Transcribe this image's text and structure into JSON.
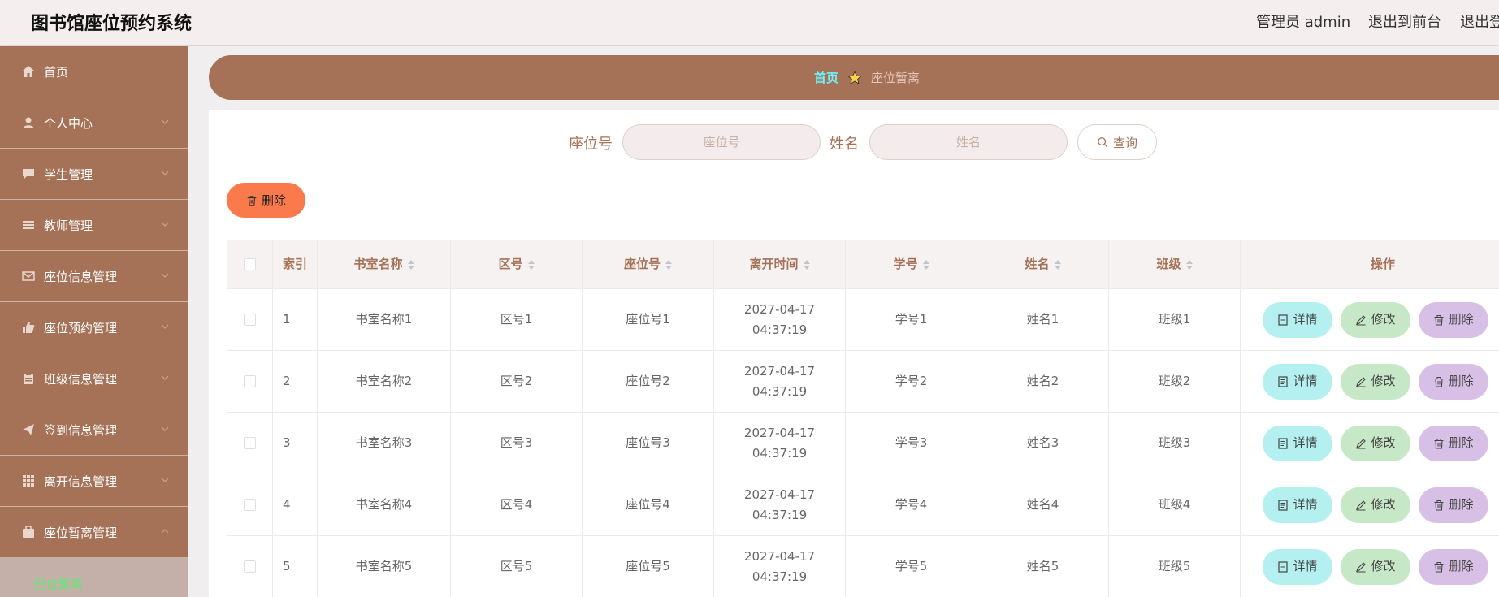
{
  "header": {
    "title": "图书馆座位预约系统",
    "admin": "管理员 admin",
    "to_front": "退出到前台",
    "logout": "退出登录"
  },
  "sidebar": {
    "items": [
      {
        "label": "首页",
        "icon": "home-icon"
      },
      {
        "label": "个人中心",
        "icon": "user-icon"
      },
      {
        "label": "学生管理",
        "icon": "chat-icon"
      },
      {
        "label": "教师管理",
        "icon": "list-icon"
      },
      {
        "label": "座位信息管理",
        "icon": "mail-icon"
      },
      {
        "label": "座位预约管理",
        "icon": "thumb-icon"
      },
      {
        "label": "班级信息管理",
        "icon": "clipboard-icon"
      },
      {
        "label": "签到信息管理",
        "icon": "send-icon"
      },
      {
        "label": "离开信息管理",
        "icon": "grid-icon"
      },
      {
        "label": "座位暂离管理",
        "icon": "briefcase-icon"
      }
    ],
    "active_sub": "座位暂离"
  },
  "breadcrumb": {
    "home": "首页",
    "current": "座位暂离"
  },
  "search": {
    "seat_label": "座位号",
    "seat_placeholder": "座位号",
    "name_label": "姓名",
    "name_placeholder": "姓名",
    "query_label": "查询"
  },
  "actions": {
    "batch_delete": "删除",
    "detail": "详情",
    "edit": "修改",
    "delete": "删除"
  },
  "table": {
    "headers": [
      "索引",
      "书室名称",
      "区号",
      "座位号",
      "离开时间",
      "学号",
      "姓名",
      "班级",
      "操作"
    ],
    "rows": [
      [
        "1",
        "书室名称1",
        "区号1",
        "座位号1",
        "2027-04-17 04:37:19",
        "学号1",
        "姓名1",
        "班级1"
      ],
      [
        "2",
        "书室名称2",
        "区号2",
        "座位号2",
        "2027-04-17 04:37:19",
        "学号2",
        "姓名2",
        "班级2"
      ],
      [
        "3",
        "书室名称3",
        "区号3",
        "座位号3",
        "2027-04-17 04:37:19",
        "学号3",
        "姓名3",
        "班级3"
      ],
      [
        "4",
        "书室名称4",
        "区号4",
        "座位号4",
        "2027-04-17 04:37:19",
        "学号4",
        "姓名4",
        "班级4"
      ],
      [
        "5",
        "书室名称5",
        "区号5",
        "座位号5",
        "2027-04-17 04:37:19",
        "学号5",
        "姓名5",
        "班级5"
      ]
    ]
  },
  "colors": {
    "brand": "#a57157",
    "breadcrumb_home": "#6df4ff",
    "batch_delete": "#fb7a4c",
    "detail_btn": "#b4f0f0",
    "edit_btn": "#c6e8c6",
    "delete_btn": "#d8bfe6",
    "active_sub_text": "#5fe874"
  }
}
